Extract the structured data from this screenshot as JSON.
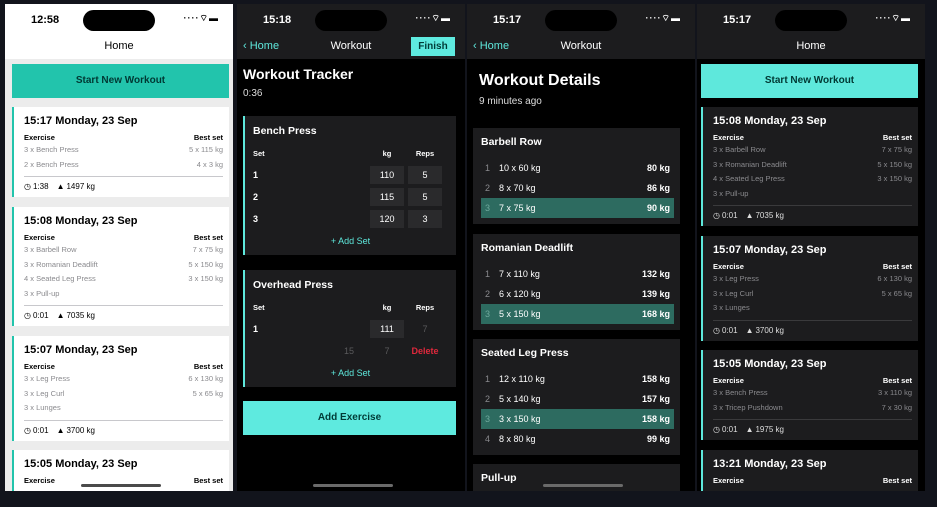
{
  "colors": {
    "accent": "#22c4ac",
    "accent_dark": "#5ee8dc",
    "delete": "#e0283c"
  },
  "screen1": {
    "time": "12:58",
    "title": "Home",
    "start_label": "Start New Workout",
    "exercise_label": "Exercise",
    "best_label": "Best set",
    "cards": [
      {
        "title": "15:17 Monday, 23 Sep",
        "rows": [
          {
            "ex": "3 x Bench Press",
            "best": "5 x 115 kg"
          },
          {
            "ex": "2 x Bench Press",
            "best": "4 x 3 kg"
          }
        ],
        "duration": "1:38",
        "weight": "1497 kg"
      },
      {
        "title": "15:08 Monday, 23 Sep",
        "rows": [
          {
            "ex": "3 x Barbell Row",
            "best": "7 x 75 kg"
          },
          {
            "ex": "3 x Romanian Deadlift",
            "best": "5 x 150 kg"
          },
          {
            "ex": "4 x Seated Leg Press",
            "best": "3 x 150 kg"
          },
          {
            "ex": "3 x Pull-up",
            "best": ""
          }
        ],
        "duration": "0:01",
        "weight": "7035 kg"
      },
      {
        "title": "15:07 Monday, 23 Sep",
        "rows": [
          {
            "ex": "3 x Leg Press",
            "best": "6 x 130 kg"
          },
          {
            "ex": "3 x Leg Curl",
            "best": "5 x 65 kg"
          },
          {
            "ex": "3 x Lunges",
            "best": ""
          }
        ],
        "duration": "0:01",
        "weight": "3700 kg"
      },
      {
        "title": "15:05 Monday, 23 Sep",
        "rows": [],
        "duration": "",
        "weight": ""
      }
    ]
  },
  "screen2": {
    "time": "15:18",
    "back": "Home",
    "nav_title": "Workout",
    "finish": "Finish",
    "title": "Workout Tracker",
    "elapsed": "0:36",
    "set_label": "Set",
    "kg_label": "kg",
    "reps_label": "Reps",
    "add_set": "+ Add Set",
    "bench": {
      "name": "Bench Press",
      "sets": [
        {
          "n": "1",
          "kg": "110",
          "reps": "5"
        },
        {
          "n": "2",
          "kg": "115",
          "reps": "5"
        },
        {
          "n": "3",
          "kg": "120",
          "reps": "3"
        }
      ]
    },
    "ohp": {
      "name": "Overhead Press",
      "set1": {
        "n": "1",
        "kg": "111",
        "reps": "7"
      },
      "ghost_kg": "15",
      "ghost_reps": "7",
      "delete": "Delete"
    },
    "add_exercise": "Add Exercise"
  },
  "screen3": {
    "time": "15:17",
    "back": "Home",
    "nav_title": "Workout",
    "title": "Workout Details",
    "ago": "9 minutes ago",
    "blocks": [
      {
        "name": "Barbell Row",
        "rows": [
          {
            "i": "1",
            "v": "10 x 60 kg",
            "b": "80 kg"
          },
          {
            "i": "2",
            "v": "8 x 70 kg",
            "b": "86 kg"
          },
          {
            "i": "3",
            "v": "7 x 75 kg",
            "b": "90 kg"
          }
        ]
      },
      {
        "name": "Romanian Deadlift",
        "rows": [
          {
            "i": "1",
            "v": "7 x 110 kg",
            "b": "132 kg"
          },
          {
            "i": "2",
            "v": "6 x 120 kg",
            "b": "139 kg"
          },
          {
            "i": "3",
            "v": "5 x 150 kg",
            "b": "168 kg"
          }
        ]
      },
      {
        "name": "Seated Leg Press",
        "rows": [
          {
            "i": "1",
            "v": "12 x 110 kg",
            "b": "158 kg"
          },
          {
            "i": "2",
            "v": "5 x 140 kg",
            "b": "157 kg"
          },
          {
            "i": "3",
            "v": "3 x 150 kg",
            "b": "158 kg"
          },
          {
            "i": "4",
            "v": "8 x 80 kg",
            "b": "99 kg"
          }
        ]
      },
      {
        "name": "Pull-up",
        "rows": []
      }
    ]
  },
  "screen4": {
    "time": "15:17",
    "title": "Home",
    "start_label": "Start New Workout",
    "exercise_label": "Exercise",
    "best_label": "Best set",
    "cards": [
      {
        "title": "15:08 Monday, 23 Sep",
        "rows": [
          {
            "ex": "3 x Barbell Row",
            "best": "7 x 75 kg"
          },
          {
            "ex": "3 x Romanian Deadlift",
            "best": "5 x 150 kg"
          },
          {
            "ex": "4 x Seated Leg Press",
            "best": "3 x 150 kg"
          },
          {
            "ex": "3 x Pull-up",
            "best": ""
          }
        ],
        "duration": "0:01",
        "weight": "7035 kg"
      },
      {
        "title": "15:07 Monday, 23 Sep",
        "rows": [
          {
            "ex": "3 x Leg Press",
            "best": "6 x 130 kg"
          },
          {
            "ex": "3 x Leg Curl",
            "best": "5 x 65 kg"
          },
          {
            "ex": "3 x Lunges",
            "best": ""
          }
        ],
        "duration": "0:01",
        "weight": "3700 kg"
      },
      {
        "title": "15:05 Monday, 23 Sep",
        "rows": [
          {
            "ex": "3 x Bench Press",
            "best": "3 x 110 kg"
          },
          {
            "ex": "3 x Tricep Pushdown",
            "best": "7 x 30 kg"
          }
        ],
        "duration": "0:01",
        "weight": "1975 kg"
      },
      {
        "title": "13:21 Monday, 23 Sep",
        "rows": [],
        "duration": "",
        "weight": ""
      }
    ]
  }
}
